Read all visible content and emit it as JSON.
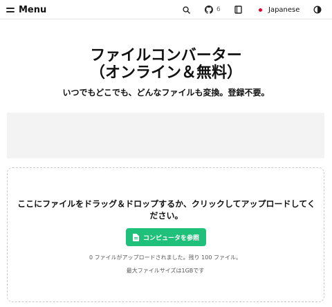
{
  "header": {
    "menu_label": "Menu",
    "github_count": "6",
    "language_label": "Japanese"
  },
  "hero": {
    "title_line1": "ファイルコンバーター",
    "title_line2": "（オンライン＆無料）",
    "subtitle": "いつでもどこでも、どんなファイルも変換。登録不要。"
  },
  "upload": {
    "instruction": "ここにファイルをドラッグ＆ドロップするか、クリックしてアップロードしてください。",
    "browse_button": "コンピュータを参照",
    "status": "0 ファイルがアップロードされました。残り 100 ファイル。",
    "max_size": "最大ファイルサイズは1GBです"
  },
  "colors": {
    "accent": "#1ec07a",
    "flag": "#e0002a",
    "ad_background": "#f3f3f3"
  },
  "icons": [
    "hamburger-icon",
    "search-icon",
    "github-icon",
    "book-icon",
    "flag-icon",
    "theme-toggle-icon",
    "file-icon"
  ]
}
